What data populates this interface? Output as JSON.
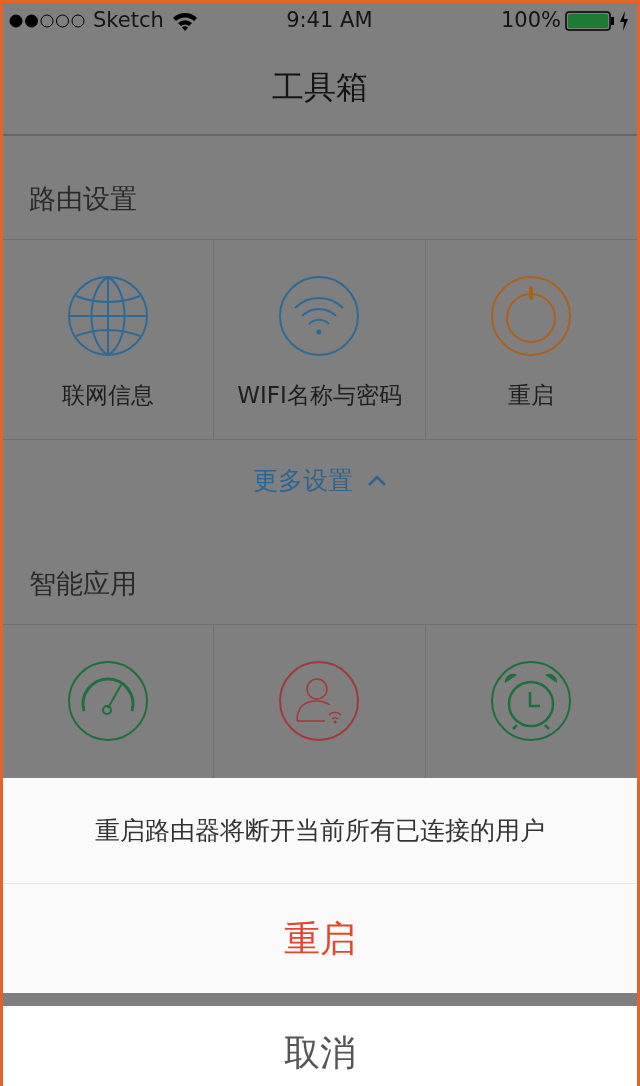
{
  "status_bar": {
    "carrier": "Sketch",
    "time": "9:41 AM",
    "battery": "100%"
  },
  "title": "工具箱",
  "sections": [
    {
      "title": "路由设置",
      "tools": [
        {
          "kind": "globe",
          "label": "联网信息",
          "color": "#2f6a96"
        },
        {
          "kind": "wifi",
          "label": "WIFI名称与密码",
          "color": "#2f6a96"
        },
        {
          "kind": "power",
          "label": "重启",
          "color": "#a8621f"
        }
      ],
      "more": {
        "label": "更多设置",
        "expanded": true
      }
    },
    {
      "title": "智能应用",
      "tools": [
        {
          "kind": "speed",
          "color": "#1f6e3e"
        },
        {
          "kind": "guest",
          "color": "#a03a3a"
        },
        {
          "kind": "alarm",
          "color": "#1f6e3e"
        }
      ]
    }
  ],
  "action_sheet": {
    "message": "重启路由器将断开当前所有已连接的用户",
    "confirm": "重启",
    "cancel": "取消"
  }
}
